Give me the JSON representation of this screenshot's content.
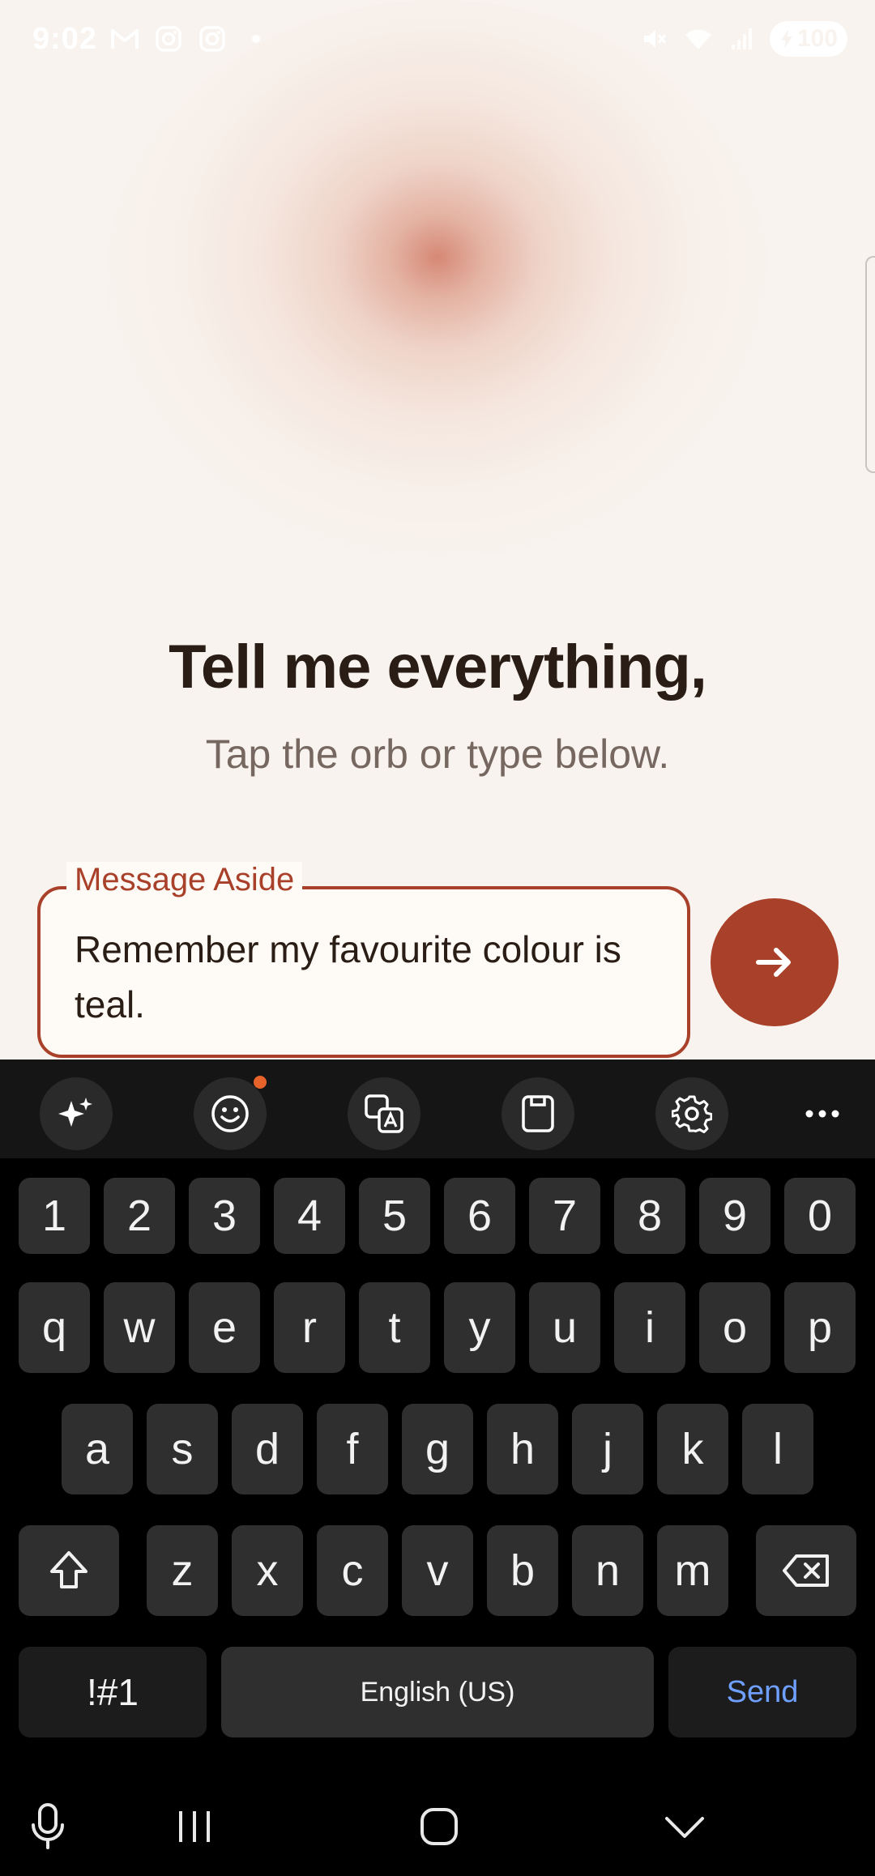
{
  "status_bar": {
    "time": "9:02",
    "battery": "100",
    "left_icons": [
      "gmail-icon",
      "instagram-icon",
      "instagram-icon",
      "dot-icon"
    ],
    "right_icons": [
      "mute-icon",
      "wifi-icon",
      "signal-icon",
      "battery-icon"
    ]
  },
  "main": {
    "headline": "Tell me everything,",
    "subtitle": "Tap the orb or type below."
  },
  "composer": {
    "label": "Message Aside",
    "text": "Remember my favourite colour is teal.",
    "send_icon": "arrow-right-icon",
    "accent_color": "#a8402a"
  },
  "keyboard": {
    "toolbar_icons": [
      "sparkle-icon",
      "emoji-icon",
      "translate-icon",
      "clipboard-icon",
      "settings-icon",
      "more-icon"
    ],
    "row_numbers": [
      "1",
      "2",
      "3",
      "4",
      "5",
      "6",
      "7",
      "8",
      "9",
      "0"
    ],
    "row_1": [
      "q",
      "w",
      "e",
      "r",
      "t",
      "y",
      "u",
      "i",
      "o",
      "p"
    ],
    "row_2": [
      "a",
      "s",
      "d",
      "f",
      "g",
      "h",
      "j",
      "k",
      "l"
    ],
    "row_3": [
      "z",
      "x",
      "c",
      "v",
      "b",
      "n",
      "m"
    ],
    "symbols_key": "!#1",
    "space_key": "English (US)",
    "send_key": "Send",
    "send_color": "#6fa0ff"
  },
  "nav_bar": {
    "icons": [
      "microphone-icon",
      "recents-icon",
      "home-icon",
      "collapse-keyboard-icon"
    ]
  }
}
